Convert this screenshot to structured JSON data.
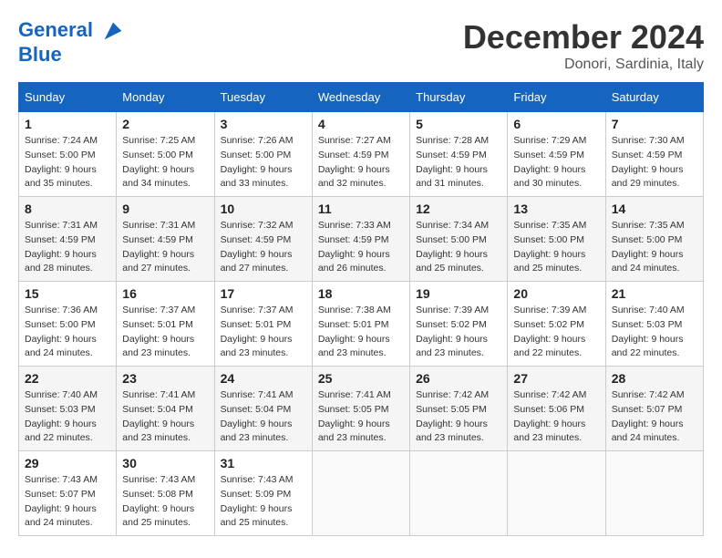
{
  "header": {
    "logo_line1": "General",
    "logo_line2": "Blue",
    "month_title": "December 2024",
    "location": "Donori, Sardinia, Italy"
  },
  "weekdays": [
    "Sunday",
    "Monday",
    "Tuesday",
    "Wednesday",
    "Thursday",
    "Friday",
    "Saturday"
  ],
  "weeks": [
    [
      {
        "day": "1",
        "sunrise": "7:24 AM",
        "sunset": "5:00 PM",
        "daylight": "9 hours and 35 minutes."
      },
      {
        "day": "2",
        "sunrise": "7:25 AM",
        "sunset": "5:00 PM",
        "daylight": "9 hours and 34 minutes."
      },
      {
        "day": "3",
        "sunrise": "7:26 AM",
        "sunset": "5:00 PM",
        "daylight": "9 hours and 33 minutes."
      },
      {
        "day": "4",
        "sunrise": "7:27 AM",
        "sunset": "4:59 PM",
        "daylight": "9 hours and 32 minutes."
      },
      {
        "day": "5",
        "sunrise": "7:28 AM",
        "sunset": "4:59 PM",
        "daylight": "9 hours and 31 minutes."
      },
      {
        "day": "6",
        "sunrise": "7:29 AM",
        "sunset": "4:59 PM",
        "daylight": "9 hours and 30 minutes."
      },
      {
        "day": "7",
        "sunrise": "7:30 AM",
        "sunset": "4:59 PM",
        "daylight": "9 hours and 29 minutes."
      }
    ],
    [
      {
        "day": "8",
        "sunrise": "7:31 AM",
        "sunset": "4:59 PM",
        "daylight": "9 hours and 28 minutes."
      },
      {
        "day": "9",
        "sunrise": "7:31 AM",
        "sunset": "4:59 PM",
        "daylight": "9 hours and 27 minutes."
      },
      {
        "day": "10",
        "sunrise": "7:32 AM",
        "sunset": "4:59 PM",
        "daylight": "9 hours and 27 minutes."
      },
      {
        "day": "11",
        "sunrise": "7:33 AM",
        "sunset": "4:59 PM",
        "daylight": "9 hours and 26 minutes."
      },
      {
        "day": "12",
        "sunrise": "7:34 AM",
        "sunset": "5:00 PM",
        "daylight": "9 hours and 25 minutes."
      },
      {
        "day": "13",
        "sunrise": "7:35 AM",
        "sunset": "5:00 PM",
        "daylight": "9 hours and 25 minutes."
      },
      {
        "day": "14",
        "sunrise": "7:35 AM",
        "sunset": "5:00 PM",
        "daylight": "9 hours and 24 minutes."
      }
    ],
    [
      {
        "day": "15",
        "sunrise": "7:36 AM",
        "sunset": "5:00 PM",
        "daylight": "9 hours and 24 minutes."
      },
      {
        "day": "16",
        "sunrise": "7:37 AM",
        "sunset": "5:01 PM",
        "daylight": "9 hours and 23 minutes."
      },
      {
        "day": "17",
        "sunrise": "7:37 AM",
        "sunset": "5:01 PM",
        "daylight": "9 hours and 23 minutes."
      },
      {
        "day": "18",
        "sunrise": "7:38 AM",
        "sunset": "5:01 PM",
        "daylight": "9 hours and 23 minutes."
      },
      {
        "day": "19",
        "sunrise": "7:39 AM",
        "sunset": "5:02 PM",
        "daylight": "9 hours and 23 minutes."
      },
      {
        "day": "20",
        "sunrise": "7:39 AM",
        "sunset": "5:02 PM",
        "daylight": "9 hours and 22 minutes."
      },
      {
        "day": "21",
        "sunrise": "7:40 AM",
        "sunset": "5:03 PM",
        "daylight": "9 hours and 22 minutes."
      }
    ],
    [
      {
        "day": "22",
        "sunrise": "7:40 AM",
        "sunset": "5:03 PM",
        "daylight": "9 hours and 22 minutes."
      },
      {
        "day": "23",
        "sunrise": "7:41 AM",
        "sunset": "5:04 PM",
        "daylight": "9 hours and 23 minutes."
      },
      {
        "day": "24",
        "sunrise": "7:41 AM",
        "sunset": "5:04 PM",
        "daylight": "9 hours and 23 minutes."
      },
      {
        "day": "25",
        "sunrise": "7:41 AM",
        "sunset": "5:05 PM",
        "daylight": "9 hours and 23 minutes."
      },
      {
        "day": "26",
        "sunrise": "7:42 AM",
        "sunset": "5:05 PM",
        "daylight": "9 hours and 23 minutes."
      },
      {
        "day": "27",
        "sunrise": "7:42 AM",
        "sunset": "5:06 PM",
        "daylight": "9 hours and 23 minutes."
      },
      {
        "day": "28",
        "sunrise": "7:42 AM",
        "sunset": "5:07 PM",
        "daylight": "9 hours and 24 minutes."
      }
    ],
    [
      {
        "day": "29",
        "sunrise": "7:43 AM",
        "sunset": "5:07 PM",
        "daylight": "9 hours and 24 minutes."
      },
      {
        "day": "30",
        "sunrise": "7:43 AM",
        "sunset": "5:08 PM",
        "daylight": "9 hours and 25 minutes."
      },
      {
        "day": "31",
        "sunrise": "7:43 AM",
        "sunset": "5:09 PM",
        "daylight": "9 hours and 25 minutes."
      },
      null,
      null,
      null,
      null
    ]
  ]
}
